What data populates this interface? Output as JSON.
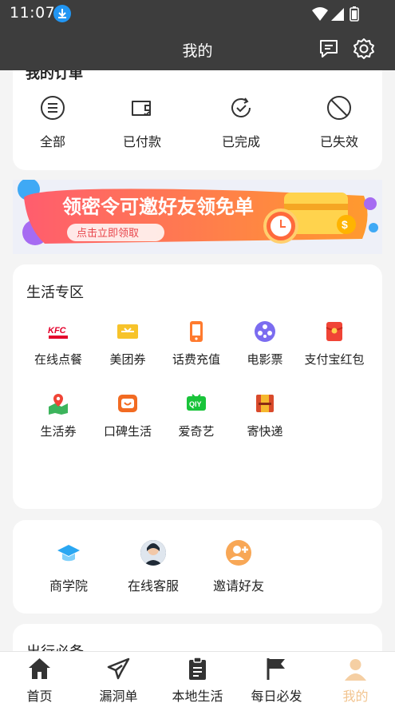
{
  "status_bar": {
    "time": "11:07",
    "icons": [
      "download-badge-icon",
      "wifi-icon",
      "signal-icon",
      "battery-icon"
    ]
  },
  "header": {
    "title": "我的",
    "icons": [
      "message-icon",
      "settings-icon"
    ]
  },
  "orders": {
    "title": "我的订单",
    "items": [
      {
        "label": "全部",
        "icon": "list-circle-icon"
      },
      {
        "label": "已付款",
        "icon": "wallet-check-icon"
      },
      {
        "label": "已完成",
        "icon": "refresh-check-icon"
      },
      {
        "label": "已失效",
        "icon": "invalid-circle-icon"
      }
    ]
  },
  "banner": {
    "headline": "领密令可邀好友领免单",
    "button": "点击立即领取"
  },
  "life": {
    "title": "生活专区",
    "items": [
      {
        "label": "在线点餐",
        "icon": "kfc-icon",
        "icon_text": "KFC",
        "color": "#e4002b"
      },
      {
        "label": "美团券",
        "icon": "meituan-ticket-icon",
        "color": "#f7c32a"
      },
      {
        "label": "话费充值",
        "icon": "phone-recharge-icon",
        "color": "#ff7a2e"
      },
      {
        "label": "电影票",
        "icon": "film-reel-icon",
        "color": "#7b6cf0"
      },
      {
        "label": "支付宝红包",
        "icon": "red-envelope-icon",
        "color": "#f04436"
      },
      {
        "label": "生活券",
        "icon": "map-pin-icon",
        "color": "#3cb45c"
      },
      {
        "label": "口碑生活",
        "icon": "koubei-icon",
        "color": "#f26b22"
      },
      {
        "label": "爱奇艺",
        "icon": "iqiyi-icon",
        "icon_text": "QIY",
        "color": "#19c43a"
      },
      {
        "label": "寄快递",
        "icon": "parcel-icon",
        "color": "#d94a2b"
      }
    ]
  },
  "services": {
    "items": [
      {
        "label": "商学院",
        "icon": "graduation-cap-icon",
        "color": "#2aa7f2"
      },
      {
        "label": "在线客服",
        "icon": "agent-avatar-icon",
        "color": "#34495e"
      },
      {
        "label": "邀请好友",
        "icon": "add-friend-icon",
        "color": "#f8a756"
      }
    ]
  },
  "travel": {
    "title": "出行必备"
  },
  "tabs": [
    {
      "label": "首页",
      "icon": "home-icon",
      "active": false
    },
    {
      "label": "漏洞单",
      "icon": "send-icon",
      "active": false
    },
    {
      "label": "本地生活",
      "icon": "clipboard-icon",
      "active": false
    },
    {
      "label": "每日必发",
      "icon": "flag-icon",
      "active": false
    },
    {
      "label": "我的",
      "icon": "user-icon",
      "active": true
    }
  ],
  "colors": {
    "header_bg": "#3d3d3d",
    "active_tab": "#f2c48f",
    "banner_gradient_start": "#ff5b5b",
    "banner_gradient_end": "#ff8b2f"
  }
}
